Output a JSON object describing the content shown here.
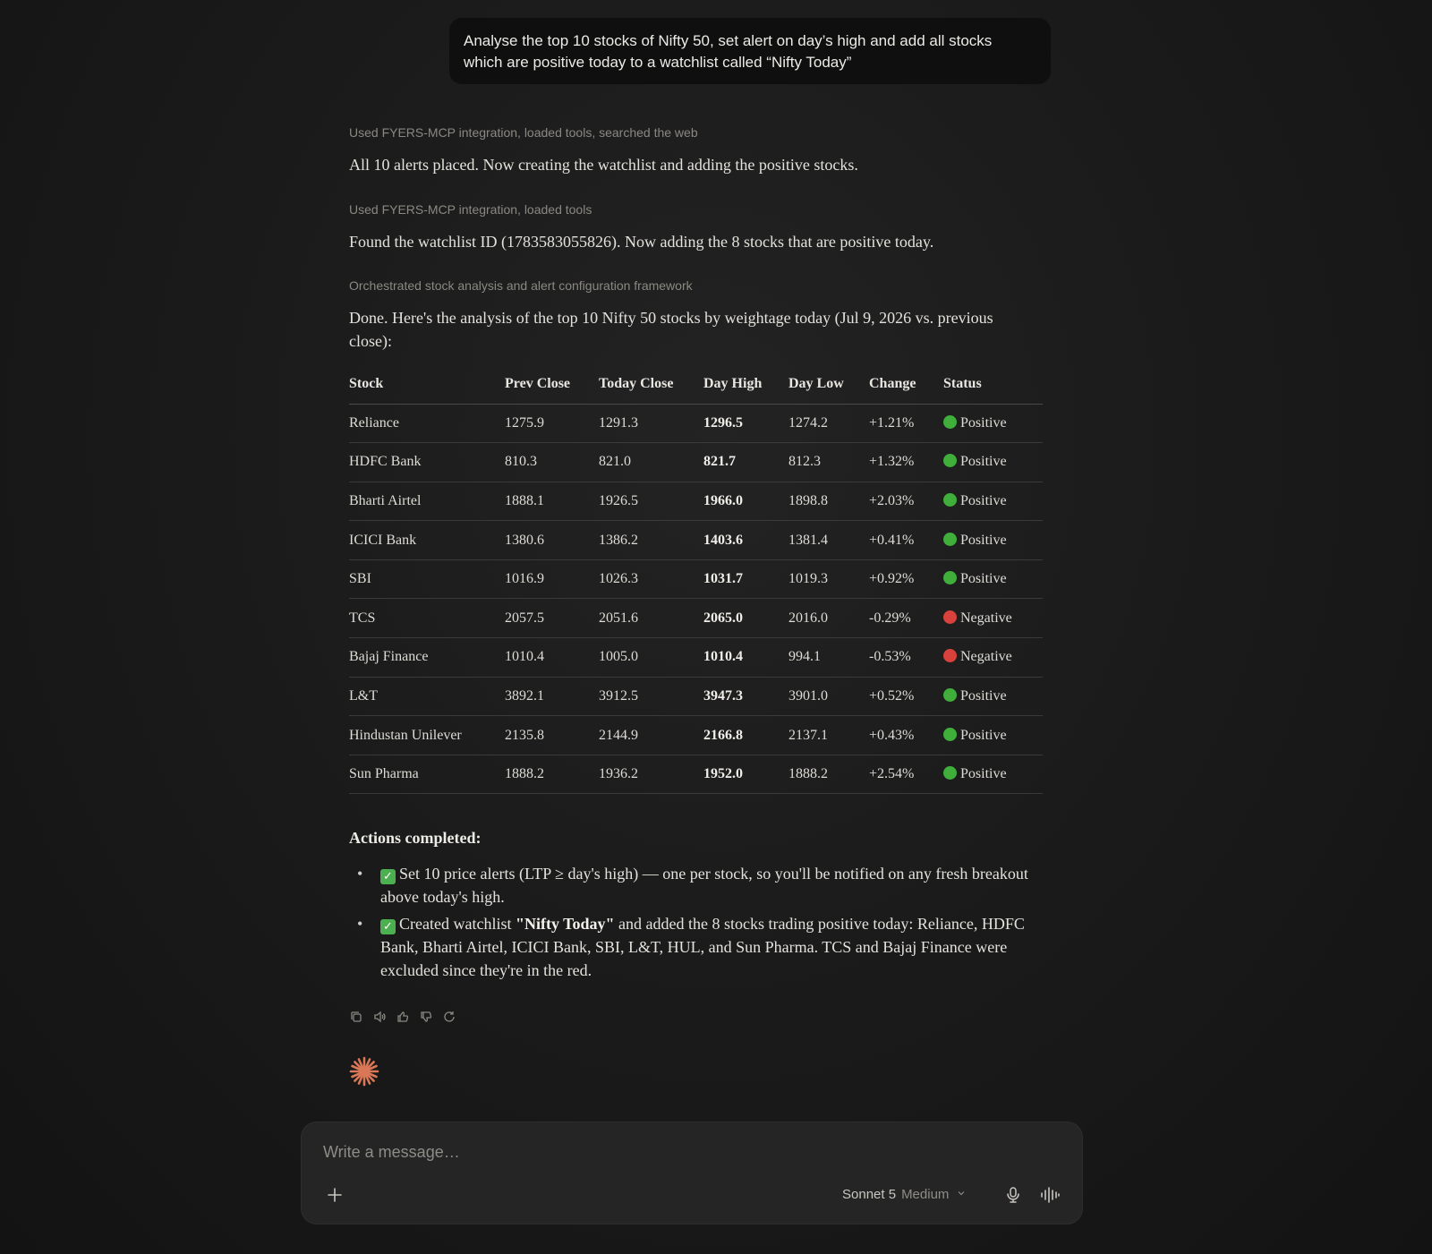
{
  "user_message": {
    "line1": "Analyse the top 10 stocks of Nifty 50, set alert on day’s high and add all stocks",
    "line2": "which are positive today to a watchlist called “Nifty Today”"
  },
  "steps": [
    {
      "label": "Used FYERS-MCP integration, loaded tools, searched the web",
      "text": "All 10 alerts placed. Now creating the watchlist and adding the positive stocks."
    },
    {
      "label": "Used FYERS-MCP integration, loaded tools",
      "text": "Found the watchlist ID (1783583055826). Now adding the 8 stocks that are positive today."
    },
    {
      "label": "Orchestrated stock analysis and alert configuration framework",
      "text": "Done. Here's the analysis of the top 10 Nifty 50 stocks by weightage today (Jul 9, 2026 vs. previous close):"
    }
  ],
  "table": {
    "headers": [
      "Stock",
      "Prev Close",
      "Today Close",
      "Day High",
      "Day Low",
      "Change",
      "Status"
    ],
    "rows": [
      [
        "Reliance",
        "1275.9",
        "1291.3",
        "1296.5",
        "1274.2",
        "+1.21%",
        "Positive"
      ],
      [
        "HDFC Bank",
        "810.3",
        "821.0",
        "821.7",
        "812.3",
        "+1.32%",
        "Positive"
      ],
      [
        "Bharti Airtel",
        "1888.1",
        "1926.5",
        "1966.0",
        "1898.8",
        "+2.03%",
        "Positive"
      ],
      [
        "ICICI Bank",
        "1380.6",
        "1386.2",
        "1403.6",
        "1381.4",
        "+0.41%",
        "Positive"
      ],
      [
        "SBI",
        "1016.9",
        "1026.3",
        "1031.7",
        "1019.3",
        "+0.92%",
        "Positive"
      ],
      [
        "TCS",
        "2057.5",
        "2051.6",
        "2065.0",
        "2016.0",
        "-0.29%",
        "Negative"
      ],
      [
        "Bajaj Finance",
        "1010.4",
        "1005.0",
        "1010.4",
        "994.1",
        "-0.53%",
        "Negative"
      ],
      [
        "L&T",
        "3892.1",
        "3912.5",
        "3947.3",
        "3901.0",
        "+0.52%",
        "Positive"
      ],
      [
        "Hindustan Unilever",
        "2135.8",
        "2144.9",
        "2166.8",
        "2137.1",
        "+0.43%",
        "Positive"
      ],
      [
        "Sun Pharma",
        "1888.2",
        "1936.2",
        "1952.0",
        "1888.2",
        "+2.54%",
        "Positive"
      ]
    ]
  },
  "status_colors": {
    "Positive": "#3fae3a",
    "Negative": "#d9423c"
  },
  "actions": {
    "title": "Actions completed:",
    "item1": "Set 10 price alerts (LTP ≥ day's high) — one per stock, so you'll be notified on any fresh breakout above today's high.",
    "item2_pre": "Created watchlist ",
    "item2_bold": "\"Nifty Today\"",
    "item2_post": " and added the 8 stocks trading positive today: Reliance, HDFC Bank, Bharti Airtel, ICICI Bank, SBI, L&T, HUL, and Sun Pharma. TCS and Bajaj Finance were excluded since they're in the red."
  },
  "composer": {
    "placeholder": "Write a message…",
    "model": "Sonnet 5",
    "effort": "Medium"
  },
  "icons": [
    "copy-icon",
    "speaker-icon",
    "thumbs-up-icon",
    "thumbs-down-icon",
    "retry-icon",
    "spark-icon",
    "plus-icon",
    "chevron-down-icon",
    "mic-icon",
    "voice-mode-icon",
    "check-icon"
  ],
  "accent_color": "#d97757"
}
